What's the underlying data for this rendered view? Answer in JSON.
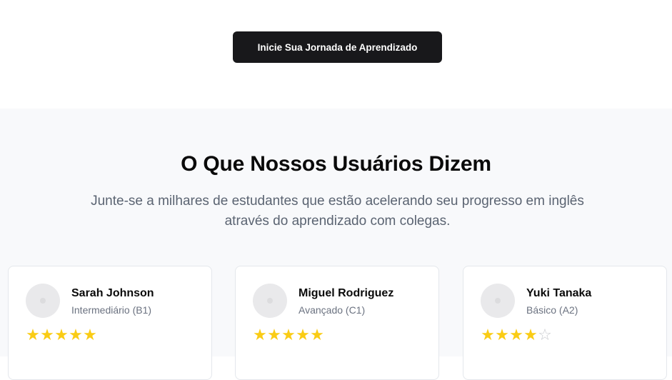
{
  "hero": {
    "cta_label": "Inicie Sua Jornada de Aprendizado"
  },
  "testimonials": {
    "title": "O Que Nossos Usuários Dizem",
    "subtitle_line1": "Junte-se a milhares de estudantes que estão acelerando seu progresso em inglês",
    "subtitle_line2": "através do aprendizado com colegas.",
    "cards": [
      {
        "name": "Sarah Johnson",
        "level": "Intermediário (B1)",
        "rating": 5,
        "max_rating": 5
      },
      {
        "name": "Miguel Rodriguez",
        "level": "Avançado (C1)",
        "rating": 5,
        "max_rating": 5
      },
      {
        "name": "Yuki Tanaka",
        "level": "Básico (A2)",
        "rating": 4,
        "max_rating": 5
      }
    ]
  },
  "colors": {
    "cta_background": "#18181b",
    "star_filled": "#facc15",
    "star_empty": "#c7c9ce",
    "band_background": "#f8f9fb"
  },
  "icons": {
    "star": "star-icon",
    "avatar": "avatar-placeholder-icon"
  }
}
